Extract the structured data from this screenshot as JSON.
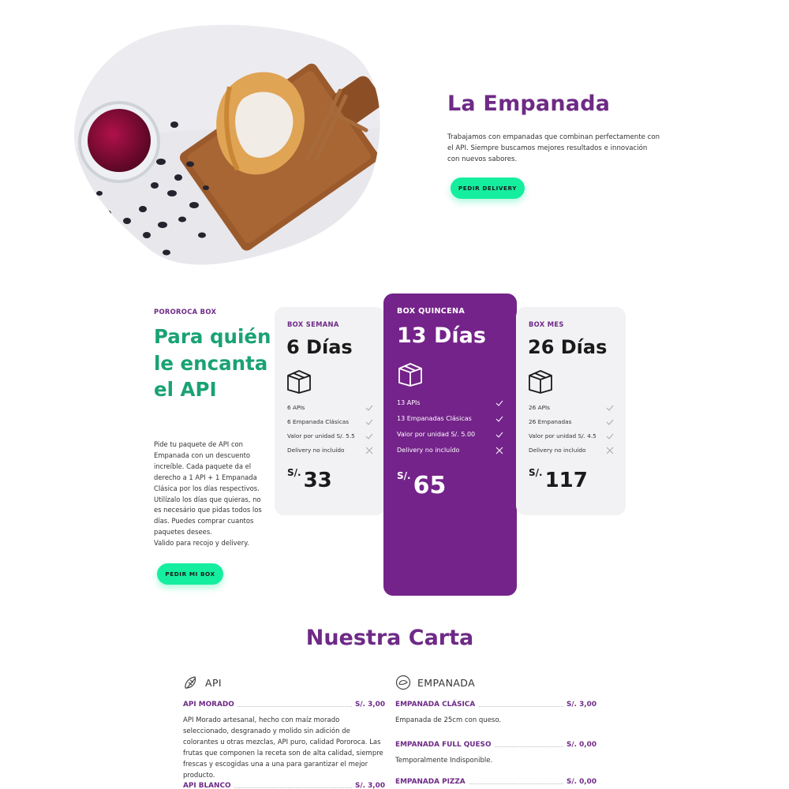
{
  "hero": {
    "title": "La Empanada",
    "description": "Trabajamos con empanadas que combinan perfectamente con el API. Siempre buscamos mejores resultados e innovación con nuevos sabores.",
    "cta_label": "PEDIR DELIVERY"
  },
  "boxes_intro": {
    "eyebrow": "POROROCA BOX",
    "heading": "Para quién le encanta el API",
    "description": "Pide tu paquete de API con Empanada con un descuento increíble. Cada paquete da el derecho a 1 API + 1 Empanada Clásica por los días respectivos. Utilízalo los días que quieras, no es necesário que pidas todos los días. Puedes comprar cuantos paquetes desees.",
    "description_2": "Valido para recojo y delivery.",
    "cta_label": "PEDIR MI BOX"
  },
  "plans": [
    {
      "label": "BOX SEMANA",
      "days": "6 Días",
      "features": [
        {
          "text": "6 APIs",
          "included": true
        },
        {
          "text": "6 Empanada Clásicas",
          "included": true
        },
        {
          "text": "Valor por unidad S/. 5.5",
          "included": true
        },
        {
          "text": "Delivery no incluído",
          "included": false
        }
      ],
      "currency": "S/.",
      "price": "33",
      "icon": "box-icon"
    },
    {
      "label": "BOX QUINCENA",
      "days": "13 Días",
      "features": [
        {
          "text": "13 APIs",
          "included": true
        },
        {
          "text": "13 Empanadas Clásicas",
          "included": true
        },
        {
          "text": "Valor por unidad S/. 5.00",
          "included": true
        },
        {
          "text": "Delivery no incluído",
          "included": false
        }
      ],
      "currency": "S/.",
      "price": "65",
      "icon": "box-icon"
    },
    {
      "label": "BOX MES",
      "days": "26 Días",
      "features": [
        {
          "text": "26 APIs",
          "included": true
        },
        {
          "text": "26 Empanadas",
          "included": true
        },
        {
          "text": "Valor por unidad S/. 4.5",
          "included": true
        },
        {
          "text": "Delivery no incluído",
          "included": false
        }
      ],
      "currency": "S/.",
      "price": "117",
      "icon": "box-icon"
    }
  ],
  "carta": {
    "title": "Nuestra Carta",
    "columns": [
      {
        "heading": "API",
        "icon": "corn-icon",
        "items": [
          {
            "name": "API MORADO",
            "price": "S/. 3,00",
            "description": "API Morado artesanal, hecho con maíz morado seleccionado, desgranado y molido sin adición de colorantes u otras mezclas, API puro, calidad Pororoca. Las frutas que componen la receta son de alta calidad, siempre frescas y escogidas una a una para garantizar el mejor producto."
          },
          {
            "name": "API BLANCO",
            "price": "S/. 3,00",
            "description": ""
          }
        ]
      },
      {
        "heading": "EMPANADA",
        "icon": "plate-icon",
        "items": [
          {
            "name": "EMPANADA CLÁSICA",
            "price": "S/. 3,00",
            "description": "Empanada de 25cm con queso."
          },
          {
            "name": "EMPANADA FULL QUESO",
            "price": "S/. 0,00",
            "description": "Temporalmente Indisponible."
          },
          {
            "name": "EMPANADA PIZZA",
            "price": "S/. 0,00",
            "description": ""
          }
        ]
      }
    ]
  },
  "colors": {
    "brand_purple": "#6e2a86",
    "card_purple": "#74238a",
    "accent_green": "#15ee9f",
    "heading_green": "#1aa274"
  }
}
